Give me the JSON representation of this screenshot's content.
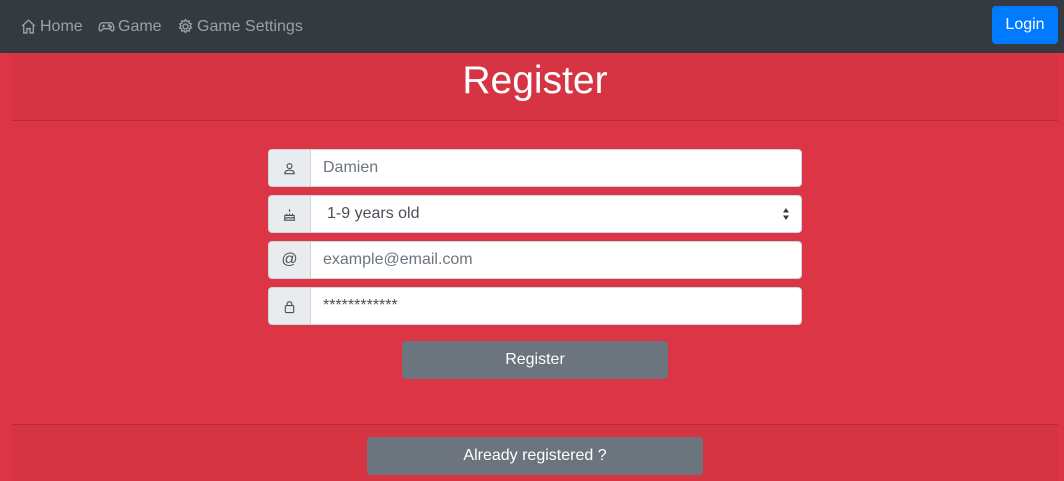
{
  "nav": {
    "home_label": "Home",
    "game_label": "Game",
    "settings_label": "Game Settings",
    "login_label": "Login"
  },
  "header": {
    "title": "Register"
  },
  "form": {
    "name_placeholder": "Damien",
    "age_selected": "1-9 years old",
    "email_symbol": "@",
    "email_placeholder": "example@email.com",
    "password_placeholder": "************",
    "submit_label": "Register"
  },
  "footer": {
    "already_label": "Already registered ?"
  },
  "colors": {
    "page_bg": "#dc3545",
    "navbar_bg": "#343a40",
    "login_button": "#007bff",
    "secondary_button": "#6c757d"
  },
  "icons": [
    "home-icon",
    "gamepad-icon",
    "gear-icon",
    "user-icon",
    "cake-icon",
    "lock-icon"
  ]
}
